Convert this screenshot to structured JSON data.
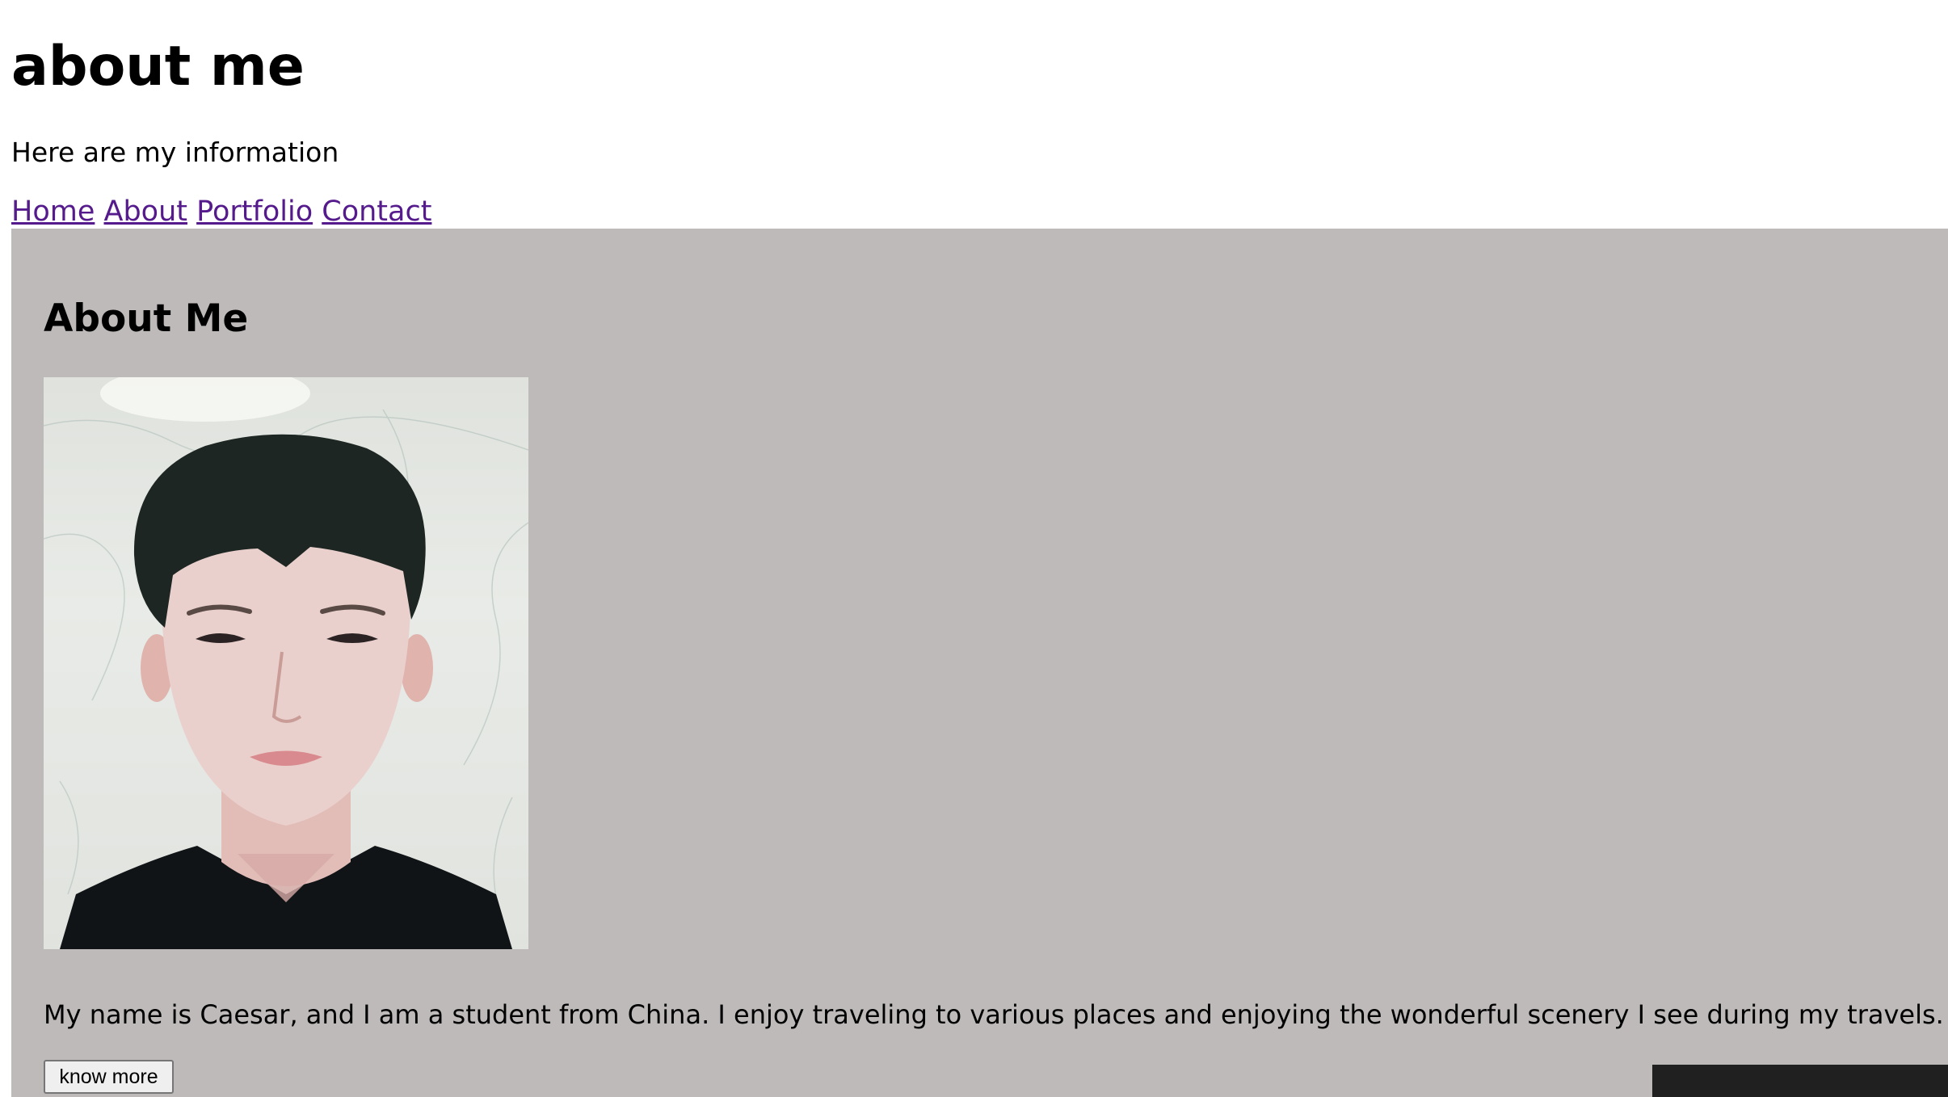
{
  "header": {
    "title": "about me",
    "tagline": "Here are my information"
  },
  "nav": {
    "items": [
      "Home",
      "About",
      "Portfolio",
      "Contact"
    ],
    "link_color": "#551a8b"
  },
  "about": {
    "title": "About Me",
    "photo": "portrait-photo",
    "bio": "My name is Caesar, and I am a student from China. I enjoy traveling to various places and enjoying the wonderful scenery I see during my travels.",
    "button_label": "know more",
    "background_color": "#bfbaba"
  }
}
